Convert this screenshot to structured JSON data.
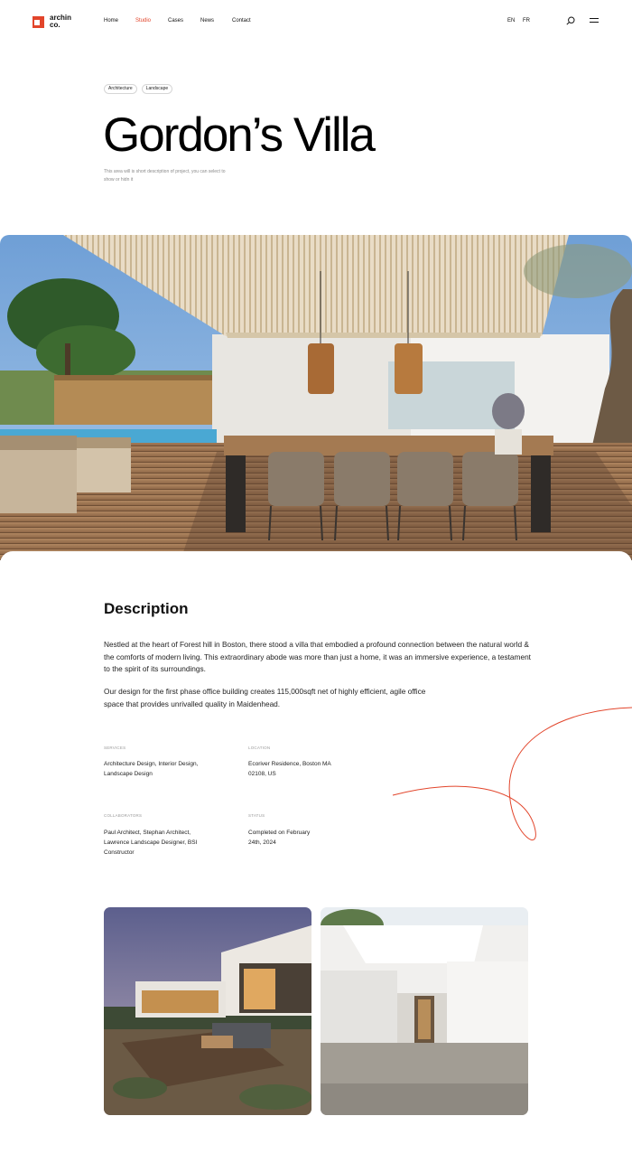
{
  "brand": {
    "name_line1": "archin",
    "name_line2": "co."
  },
  "nav": [
    "Home",
    "Studio",
    "Cases",
    "News",
    "Contact"
  ],
  "active_nav": "Studio",
  "languages": [
    "EN",
    "FR"
  ],
  "tags": [
    "Architecture",
    "Landscape"
  ],
  "project": {
    "title": "Gordon’s Villa",
    "subtitle": "This area will is short description of project, you can select to show or hidn it"
  },
  "description": {
    "heading": "Description",
    "paragraph1": "Nestled at the heart of Forest hill in Boston, there stood a villa that embodied a profound connection between the natural world & the comforts of modern living. This extraordinary abode was more than just a home, it was an immersive experience, a testament to the spirit of its surroundings.",
    "paragraph2": "Our design for the first phase office building creates 115,000sqft net of highly efficient, agile office space that provides unrivalled quality in Maidenhead."
  },
  "meta": {
    "services_label": "SERVICES",
    "services_value": "Architecture Design, Interior Design, Landscape Design",
    "location_label": "LOCATION",
    "location_value": "Ecoriver Residence, Boston MA 02108, US",
    "collaborators_label": "COLLABORATORS",
    "collaborators_value": "Paul Architect, Stephan Architect, Lawrence Landscape Designer, BSI Constructor",
    "status_label": "STATUS",
    "status_value": "Completed on February 24th, 2024"
  },
  "colors": {
    "accent": "#e2452b",
    "text": "#111111",
    "muted": "#8a8a8a"
  },
  "icons": [
    "logo-icon",
    "search-icon",
    "menu-icon"
  ]
}
